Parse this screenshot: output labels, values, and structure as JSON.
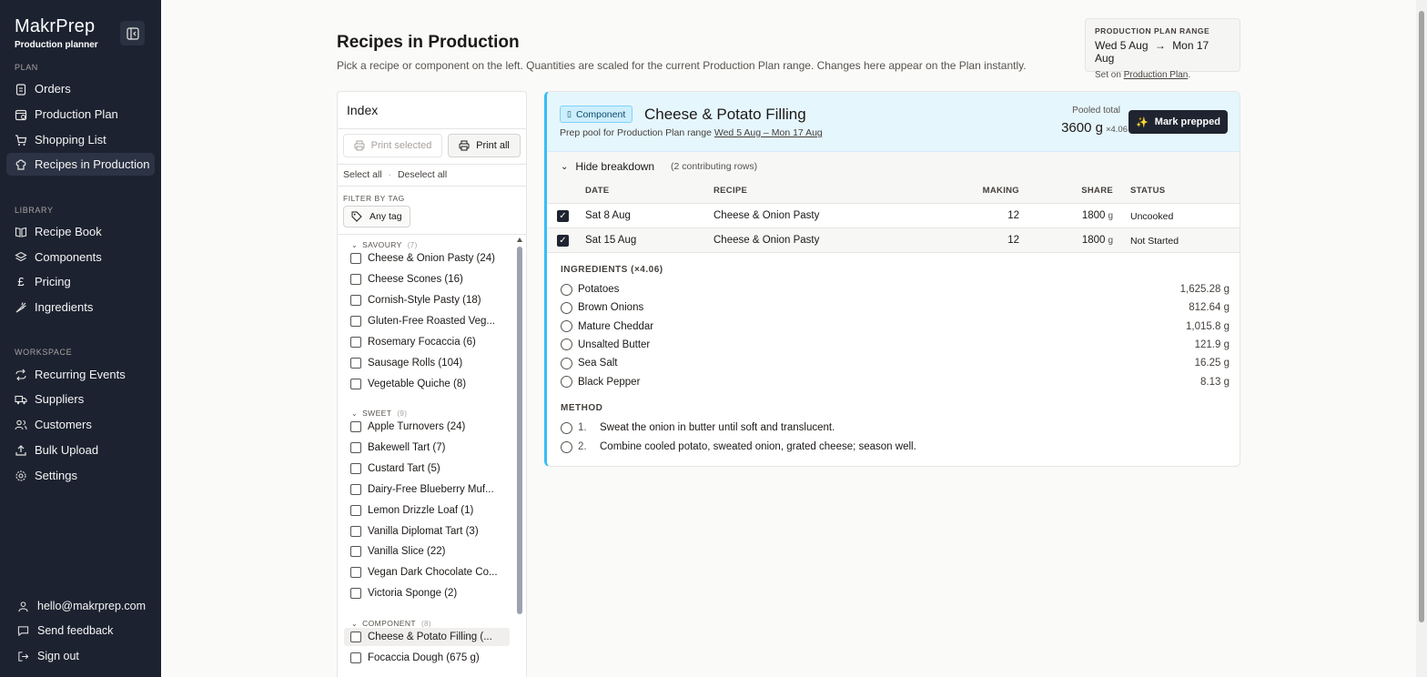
{
  "app": {
    "name": "MakrPrep",
    "subtitle": "Production planner"
  },
  "nav": {
    "plan_label": "PLAN",
    "plan": [
      {
        "label": "Orders",
        "icon": "clipboard-icon"
      },
      {
        "label": "Production Plan",
        "icon": "calendar-clock-icon"
      },
      {
        "label": "Shopping List",
        "icon": "cart-icon"
      },
      {
        "label": "Recipes in Production",
        "icon": "chef-hat-icon",
        "active": true
      }
    ],
    "library_label": "LIBRARY",
    "library": [
      {
        "label": "Recipe Book",
        "icon": "book-icon"
      },
      {
        "label": "Components",
        "icon": "layers-icon"
      },
      {
        "label": "Pricing",
        "icon": "pound-icon"
      },
      {
        "label": "Ingredients",
        "icon": "carrot-icon"
      }
    ],
    "workspace_label": "WORKSPACE",
    "workspace": [
      {
        "label": "Recurring Events",
        "icon": "repeat-icon"
      },
      {
        "label": "Suppliers",
        "icon": "truck-icon"
      },
      {
        "label": "Customers",
        "icon": "users-icon"
      },
      {
        "label": "Bulk Upload",
        "icon": "upload-icon"
      },
      {
        "label": "Settings",
        "icon": "gear-icon"
      }
    ],
    "footer": {
      "email": "hello@makrprep.com",
      "feedback": "Send feedback",
      "signout": "Sign out"
    }
  },
  "page": {
    "title": "Recipes in Production",
    "subtitle": "Pick a recipe or component on the left. Quantities are scaled for the current Production Plan range. Changes here appear on the Plan instantly."
  },
  "range": {
    "label": "PRODUCTION PLAN RANGE",
    "from": "Wed 5 Aug",
    "arrow": "→",
    "to": "Mon 17 Aug",
    "note_prefix": "Set on",
    "note_link": "Production Plan",
    "note_suffix": "."
  },
  "index": {
    "title": "Index",
    "print_selected": "Print selected",
    "print_all": "Print all",
    "select_all": "Select all",
    "sep": "·",
    "deselect_all": "Deselect all",
    "filter_label": "FILTER BY TAG",
    "any_tag": "Any tag",
    "groups": [
      {
        "name": "SAVOURY",
        "count": "(7)",
        "items": [
          "Cheese & Onion Pasty (24)",
          "Cheese Scones (16)",
          "Cornish-Style Pasty (18)",
          "Gluten-Free Roasted Veg...",
          "Rosemary Focaccia (6)",
          "Sausage Rolls (104)",
          "Vegetable Quiche (8)"
        ]
      },
      {
        "name": "SWEET",
        "count": "(9)",
        "items": [
          "Apple Turnovers (24)",
          "Bakewell Tart (7)",
          "Custard Tart (5)",
          "Dairy-Free Blueberry Muf...",
          "Lemon Drizzle Loaf (1)",
          "Vanilla Diplomat Tart (3)",
          "Vanilla Slice (22)",
          "Vegan Dark Chocolate Co...",
          "Victoria Sponge (2)"
        ]
      },
      {
        "name": "COMPONENT",
        "count": "(8)",
        "items": [
          "Cheese & Potato Filling (...",
          "Focaccia Dough (675 g)"
        ]
      }
    ]
  },
  "detail": {
    "badge": "Component",
    "title": "Cheese & Potato Filling",
    "sub_prefix": "Prep pool for Production Plan range",
    "sub_link": "Wed 5 Aug – Mon 17 Aug",
    "pooled_label": "Pooled total",
    "pooled_value": "3600 g",
    "pooled_mult": "×4.06",
    "mark_btn": "Mark prepped",
    "breakdown_toggle": "Hide breakdown",
    "breakdown_count": "(2 contributing rows)",
    "columns": {
      "date": "DATE",
      "recipe": "RECIPE",
      "making": "MAKING",
      "share": "SHARE",
      "status": "STATUS"
    },
    "rows": [
      {
        "date": "Sat 8 Aug",
        "recipe": "Cheese & Onion Pasty",
        "making": "12",
        "share": "1800",
        "unit": "g",
        "status": "Uncooked"
      },
      {
        "date": "Sat 15 Aug",
        "recipe": "Cheese & Onion Pasty",
        "making": "12",
        "share": "1800",
        "unit": "g",
        "status": "Not Started"
      }
    ],
    "ingredients_label": "INGREDIENTS (×4.06)",
    "ingredients": [
      {
        "name": "Potatoes",
        "amount": "1,625.28 g"
      },
      {
        "name": "Brown Onions",
        "amount": "812.64 g"
      },
      {
        "name": "Mature Cheddar",
        "amount": "1,015.8 g"
      },
      {
        "name": "Unsalted Butter",
        "amount": "121.9 g"
      },
      {
        "name": "Sea Salt",
        "amount": "16.25 g"
      },
      {
        "name": "Black Pepper",
        "amount": "8.13 g"
      }
    ],
    "method_label": "METHOD",
    "method": [
      {
        "num": "1.",
        "text": "Sweat the onion in butter until soft and translucent."
      },
      {
        "num": "2.",
        "text": "Combine cooled potato, sweated onion, grated cheese; season well."
      }
    ]
  }
}
